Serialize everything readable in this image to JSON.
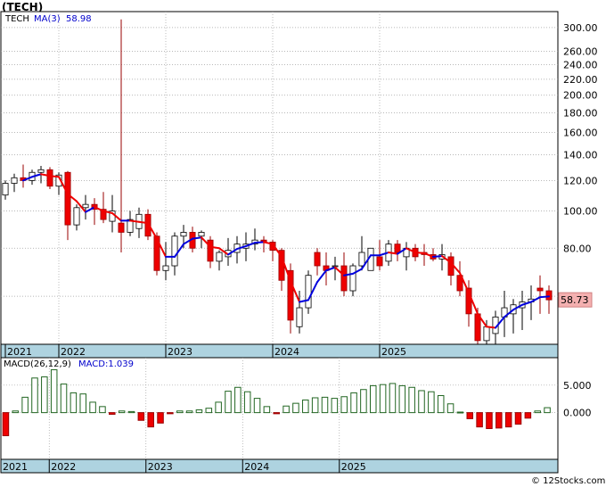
{
  "title": "(TECH)",
  "legend": {
    "ticker": "TECH",
    "ma_label": "MA(3)",
    "ma_value": "58.98"
  },
  "price_badge": "58.73",
  "macd_legend": {
    "label": "MACD(26,12,9)",
    "value": "MACD:1.039"
  },
  "watermark": "© 12Stocks.com",
  "colors": {
    "up": "#ffffff",
    "down": "#ee0000",
    "ma_up": "#0000dd",
    "ma_down": "#ee0000",
    "macd": "#226622",
    "axis_band": "#aed3e0"
  },
  "chart_data": [
    {
      "type": "candlestick",
      "y_scale": "log",
      "ylim": [
        45,
        330
      ],
      "y_ticks": [
        60,
        80,
        100,
        120,
        140,
        160,
        180,
        200,
        220,
        240,
        260,
        300
      ],
      "x_labels": [
        {
          "label": "2021",
          "month": 0
        },
        {
          "label": "2022",
          "month": 6
        },
        {
          "label": "2023",
          "month": 18
        },
        {
          "label": "2024",
          "month": 30
        },
        {
          "label": "2025",
          "month": 42
        }
      ],
      "ohlc": [
        [
          110,
          120,
          107,
          118
        ],
        [
          118,
          125,
          112,
          122
        ],
        [
          122,
          132,
          115,
          120
        ],
        [
          120,
          128,
          117,
          126
        ],
        [
          126,
          131,
          118,
          128
        ],
        [
          128,
          130,
          114,
          116
        ],
        [
          116,
          126,
          110,
          124
        ],
        [
          126,
          127,
          84,
          92
        ],
        [
          92,
          104,
          89,
          102
        ],
        [
          102,
          110,
          95,
          104
        ],
        [
          104,
          108,
          92,
          101
        ],
        [
          101,
          112,
          93,
          95
        ],
        [
          94,
          110,
          88,
          100
        ],
        [
          93,
          315,
          78,
          88
        ],
        [
          88,
          100,
          86,
          95
        ],
        [
          90,
          102,
          85,
          98
        ],
        [
          98,
          101,
          84,
          86
        ],
        [
          86,
          88,
          68,
          70
        ],
        [
          70,
          83,
          66,
          72
        ],
        [
          72,
          88,
          68,
          86
        ],
        [
          86,
          92,
          80,
          88
        ],
        [
          88,
          91,
          78,
          80
        ],
        [
          86,
          89,
          80,
          88
        ],
        [
          84,
          86,
          71,
          74
        ],
        [
          74,
          79,
          70,
          78
        ],
        [
          76,
          85,
          72,
          79
        ],
        [
          78,
          86,
          73,
          82
        ],
        [
          80,
          88,
          74,
          82
        ],
        [
          82,
          90,
          79,
          84
        ],
        [
          84,
          86,
          78,
          83
        ],
        [
          83,
          84,
          74,
          79
        ],
        [
          79,
          80,
          62,
          66
        ],
        [
          70,
          73,
          48,
          52
        ],
        [
          50,
          62,
          48,
          56
        ],
        [
          56,
          70,
          54,
          68
        ],
        [
          78,
          80,
          68,
          72
        ],
        [
          72,
          78,
          64,
          70
        ],
        [
          72,
          76,
          66,
          72
        ],
        [
          72,
          78,
          60,
          62
        ],
        [
          62,
          73,
          60,
          72
        ],
        [
          72,
          86,
          70,
          78
        ],
        [
          70,
          80,
          70,
          80
        ],
        [
          76,
          84,
          70,
          72
        ],
        [
          74,
          84,
          72,
          82
        ],
        [
          82,
          84,
          74,
          78
        ],
        [
          76,
          83,
          70,
          80
        ],
        [
          80,
          82,
          74,
          76
        ],
        [
          78,
          82,
          72,
          77
        ],
        [
          77,
          80,
          74,
          75
        ],
        [
          75,
          82,
          70,
          77
        ],
        [
          76,
          78,
          64,
          68
        ],
        [
          68,
          74,
          60,
          62
        ],
        [
          63,
          66,
          50,
          54
        ],
        [
          54,
          56,
          45,
          46
        ],
        [
          46,
          52,
          44,
          50
        ],
        [
          48,
          55,
          45,
          53
        ],
        [
          53,
          62,
          47,
          56
        ],
        [
          54,
          59,
          48,
          57
        ],
        [
          56,
          62,
          49,
          58
        ],
        [
          58,
          64,
          52,
          59
        ],
        [
          63,
          68,
          54,
          62
        ],
        [
          62,
          64,
          54,
          58.73
        ]
      ]
    },
    {
      "type": "bar",
      "name": "MACD(26,12,9)",
      "ylim": [
        -8.5,
        10
      ],
      "y_ticks": [
        0,
        5
      ],
      "y_tick_labels": [
        "0.000",
        "5.000"
      ],
      "x_labels": [
        {
          "label": "2021",
          "index": 0
        },
        {
          "label": "2022",
          "index": 5
        },
        {
          "label": "2023",
          "index": 15
        },
        {
          "label": "2024",
          "index": 25
        },
        {
          "label": "2025",
          "index": 35
        }
      ],
      "values": [
        -4.2,
        0.3,
        2.8,
        6.3,
        6.5,
        7.8,
        5.2,
        3.6,
        3.4,
        1.9,
        1.1,
        -0.3,
        0.3,
        0.2,
        -1.4,
        -2.6,
        -1.9,
        -0.2,
        0.3,
        0.3,
        0.5,
        0.8,
        1.9,
        3.9,
        4.6,
        3.8,
        2.6,
        1.1,
        -0.2,
        1.2,
        1.7,
        2.3,
        2.7,
        2.8,
        2.6,
        2.9,
        3.6,
        4.2,
        4.9,
        5.1,
        5.3,
        4.9,
        4.6,
        4.0,
        3.8,
        3.1,
        1.6,
        0.1,
        -1.1,
        -2.6,
        -2.9,
        -2.8,
        -2.6,
        -2.1,
        -1.0,
        0.3,
        0.9
      ]
    }
  ]
}
